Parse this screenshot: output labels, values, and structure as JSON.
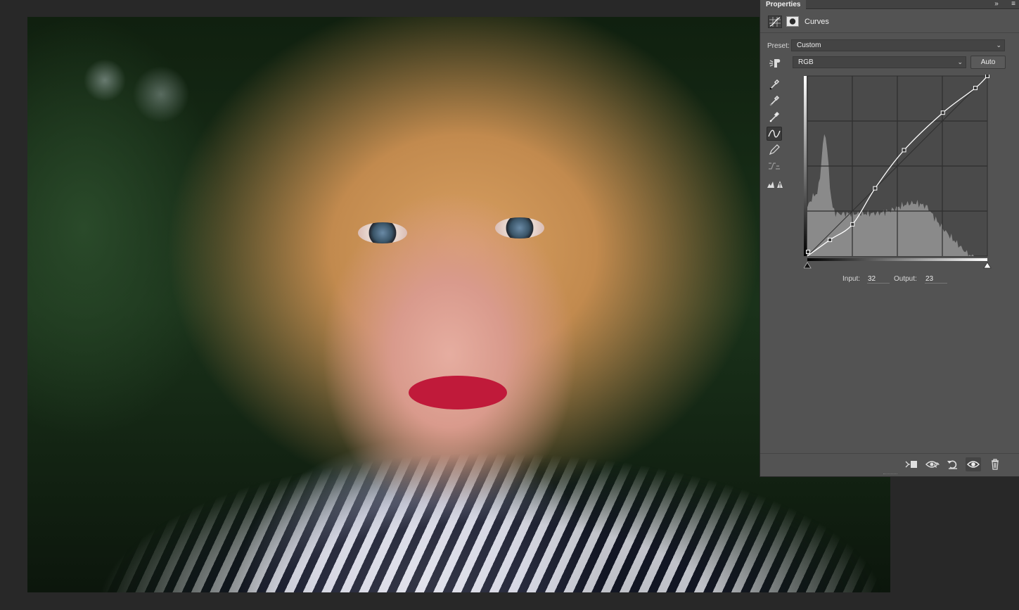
{
  "panel": {
    "tab_label": "Properties",
    "collapse_icon": "double-chevron-right",
    "menu_icon": "hamburger-menu",
    "adjustment_icon": "curves-adjustment",
    "mask_icon": "layer-mask",
    "title": "Curves"
  },
  "preset": {
    "label": "Preset:",
    "value": "Custom"
  },
  "channel": {
    "value": "RGB",
    "auto_label": "Auto"
  },
  "tools": [
    {
      "name": "targeted-adjustment-icon"
    },
    {
      "name": "black-point-eyedropper-icon"
    },
    {
      "name": "gray-point-eyedropper-icon"
    },
    {
      "name": "white-point-eyedropper-icon"
    },
    {
      "name": "edit-points-icon",
      "active": true
    },
    {
      "name": "pencil-icon"
    },
    {
      "name": "smooth-curve-icon"
    },
    {
      "name": "clipping-warning-icon"
    }
  ],
  "curve": {
    "input_label": "Input:",
    "input_value": "32",
    "output_label": "Output:",
    "output_value": "23",
    "points": [
      [
        0,
        0
      ],
      [
        32,
        23
      ],
      [
        64,
        45
      ],
      [
        96,
        96
      ],
      [
        137,
        150
      ],
      [
        192,
        203
      ],
      [
        238,
        238
      ],
      [
        255,
        255
      ]
    ],
    "line_color": "#ffffff",
    "histogram_color": "#8a8a8a"
  },
  "bottom_bar": {
    "icons": [
      "clip-to-layer-icon",
      "view-previous-state-icon",
      "reset-icon",
      "visibility-eye-icon",
      "delete-trash-icon"
    ]
  },
  "colors": {
    "panel_bg": "#535353",
    "workspace_bg": "#282828",
    "graph_bg": "#4a4a4a"
  }
}
